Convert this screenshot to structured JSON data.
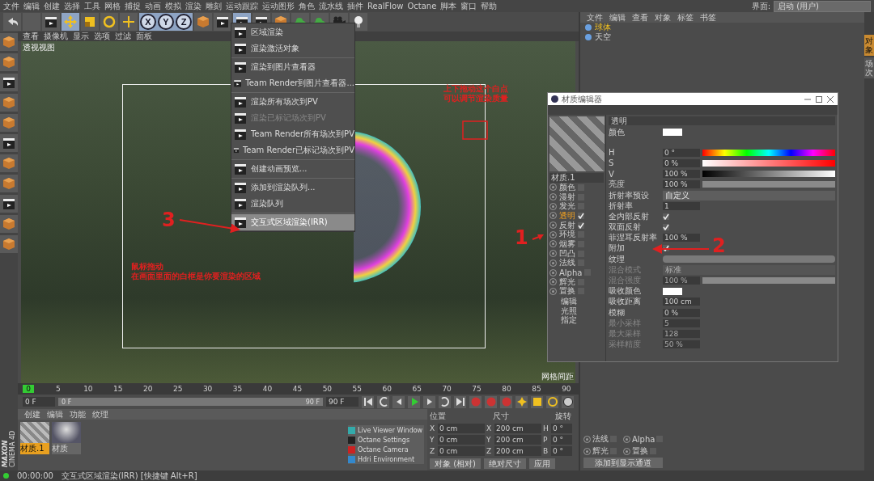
{
  "menu_bar": [
    "文件",
    "编辑",
    "创建",
    "选择",
    "工具",
    "网格",
    "捕捉",
    "动画",
    "模拟",
    "渲染",
    "雕刻",
    "运动跟踪",
    "运动图形",
    "角色",
    "流水线",
    "插件",
    "RealFlow",
    "Octane",
    "脚本",
    "窗口",
    "帮助"
  ],
  "layout_selector": {
    "label": "界面:",
    "value": "启动 (用户)"
  },
  "toolbar": {
    "axes": [
      "X",
      "Y",
      "Z"
    ]
  },
  "viewport": {
    "menu": [
      "查看",
      "摄像机",
      "显示",
      "选项",
      "过滤",
      "面板"
    ],
    "title": "透视视图",
    "footer": "网格间距"
  },
  "render_menu": [
    {
      "label": "区域渲染",
      "disabled": false,
      "selected": false,
      "separator_before": false
    },
    {
      "label": "渲染激活对象",
      "disabled": false,
      "selected": false,
      "separator_before": false
    },
    {
      "label": "渲染到图片查看器",
      "disabled": false,
      "selected": false,
      "separator_before": true
    },
    {
      "label": "Team Render到图片查看器...",
      "disabled": false,
      "selected": false,
      "separator_before": false
    },
    {
      "label": "渲染所有场次到PV",
      "disabled": false,
      "selected": false,
      "separator_before": true
    },
    {
      "label": "渲染已标记场次到PV",
      "disabled": true,
      "selected": false,
      "separator_before": false
    },
    {
      "label": "Team Render所有场次到PV",
      "disabled": false,
      "selected": false,
      "separator_before": false
    },
    {
      "label": "Team Render已标记场次到PV",
      "disabled": false,
      "selected": false,
      "separator_before": false
    },
    {
      "label": "创建动画预览...",
      "disabled": false,
      "selected": false,
      "separator_before": true
    },
    {
      "label": "添加到渲染队列...",
      "disabled": false,
      "selected": false,
      "separator_before": true
    },
    {
      "label": "渲染队列",
      "disabled": false,
      "selected": false,
      "separator_before": false
    },
    {
      "label": "交互式区域渲染(IRR)",
      "disabled": false,
      "selected": true,
      "separator_before": true
    }
  ],
  "annotations": [
    {
      "kind": "note",
      "lines": [
        "上下拖动这个白点",
        "可以调节渲染质量"
      ]
    },
    {
      "kind": "number",
      "text": "3"
    },
    {
      "kind": "number",
      "text": "1"
    },
    {
      "kind": "number",
      "text": "2"
    },
    {
      "kind": "note",
      "lines": [
        "鼠标拖动",
        "在画面里面的白框是你要渲染的区域"
      ]
    }
  ],
  "object_manager": {
    "menu": [
      "文件",
      "编辑",
      "查看",
      "对象",
      "标签",
      "书签"
    ],
    "objects": [
      {
        "name": "球体",
        "selected": true
      },
      {
        "name": "天空",
        "selected": false
      }
    ]
  },
  "side_tabs": [
    {
      "label": "对象",
      "selected": true
    },
    {
      "label": "场次",
      "selected": false
    }
  ],
  "material_editor": {
    "title": "材质编辑器",
    "material_name": "材质.1",
    "channels": [
      {
        "label": "颜色",
        "checked": false,
        "selected": false
      },
      {
        "label": "漫射",
        "checked": false,
        "selected": false
      },
      {
        "label": "发光",
        "checked": false,
        "selected": false
      },
      {
        "label": "透明",
        "checked": true,
        "selected": true
      },
      {
        "label": "反射",
        "checked": true,
        "selected": false
      },
      {
        "label": "环境",
        "checked": false,
        "selected": false
      },
      {
        "label": "烟雾",
        "checked": false,
        "selected": false
      },
      {
        "label": "凹凸",
        "checked": false,
        "selected": false
      },
      {
        "label": "法线",
        "checked": false,
        "selected": false
      },
      {
        "label": "Alpha",
        "checked": false,
        "selected": false
      },
      {
        "label": "辉光",
        "checked": false,
        "selected": false
      },
      {
        "label": "置换",
        "checked": false,
        "selected": false
      }
    ],
    "pages": [
      "编辑",
      "光照",
      "指定"
    ],
    "section": "透明",
    "params": [
      {
        "kind": "color",
        "label": "颜色",
        "color": "#ffffff",
        "disabled": false
      },
      {
        "kind": "hue",
        "label": "H",
        "value": "0 °",
        "disabled": false
      },
      {
        "kind": "saturation",
        "label": "S",
        "value": "0 %",
        "disabled": false
      },
      {
        "kind": "brightness",
        "label": "V",
        "value": "100 %",
        "disabled": false
      },
      {
        "kind": "number",
        "label": "亮度",
        "value": "100 %",
        "level": 1,
        "disabled": false
      },
      {
        "kind": "select",
        "label": "折射率预设",
        "value": "自定义",
        "disabled": false
      },
      {
        "kind": "number",
        "label": "折射率",
        "value": "1",
        "disabled": false
      },
      {
        "kind": "check",
        "label": "全内部反射",
        "checked": true,
        "disabled": false
      },
      {
        "kind": "check",
        "label": "双面反射",
        "checked": true,
        "disabled": false
      },
      {
        "kind": "number",
        "label": "菲涅耳反射率",
        "value": "100 %",
        "disabled": false
      },
      {
        "kind": "check",
        "label": "附加",
        "checked": true,
        "disabled": false
      },
      {
        "kind": "texture",
        "label": "纹理",
        "disabled": false
      },
      {
        "kind": "select",
        "label": "混合模式",
        "value": "标准",
        "disabled": true
      },
      {
        "kind": "number",
        "label": "混合强度",
        "value": "100 %",
        "level": 1,
        "disabled": true
      },
      {
        "kind": "color",
        "label": "吸收颜色",
        "color": "#ffffff",
        "disabled": false
      },
      {
        "kind": "number",
        "label": "吸收距离",
        "value": "100 cm",
        "disabled": false
      },
      {
        "kind": "number",
        "label": "模糊",
        "value": "0 %",
        "disabled": false
      },
      {
        "kind": "number",
        "label": "最小采样",
        "value": "5",
        "disabled": true
      },
      {
        "kind": "number",
        "label": "最大采样",
        "value": "128",
        "disabled": true
      },
      {
        "kind": "number",
        "label": "采样精度",
        "value": "50 %",
        "disabled": true
      }
    ]
  },
  "timeline": {
    "ticks": [
      "0",
      "5",
      "10",
      "15",
      "20",
      "25",
      "30",
      "35",
      "40",
      "45",
      "50",
      "55",
      "60",
      "65",
      "70",
      "75",
      "80",
      "85",
      "90"
    ],
    "start": "0 F",
    "level": 1,
    "range_start": "0 F",
    "range_end": "90 F",
    "end": "90 F"
  },
  "material_panel": {
    "menu": [
      "创建",
      "编辑",
      "功能",
      "纹理"
    ],
    "materials": [
      {
        "name": "材质.1",
        "selected": true
      },
      {
        "name": "材质",
        "selected": false
      }
    ]
  },
  "octane_menu": [
    "Live Viewer Window",
    "Octane Settings",
    "Octane Camera",
    "Hdri Environment"
  ],
  "coordinates": {
    "headers": [
      "位置",
      "尺寸",
      "旋转"
    ],
    "rows": [
      {
        "pos_axis": "X",
        "position": "0 cm",
        "size_axis": "X",
        "size": "200 cm",
        "rot_axis": "H",
        "rotation": "0 °"
      },
      {
        "pos_axis": "Y",
        "position": "0 cm",
        "size_axis": "Y",
        "size": "200 cm",
        "rot_axis": "P",
        "rotation": "0 °"
      },
      {
        "pos_axis": "Z",
        "position": "0 cm",
        "size_axis": "Z",
        "size": "200 cm",
        "rot_axis": "B",
        "rotation": "0 °"
      }
    ],
    "selectors": [
      "对象 (相对)",
      "绝对尺寸"
    ],
    "apply": "应用"
  },
  "attributes": {
    "channels": [
      {
        "label": "法线",
        "checked": false
      },
      {
        "label": "Alpha",
        "checked": false
      },
      {
        "label": "辉光",
        "checked": false
      },
      {
        "label": "置换",
        "checked": false
      }
    ],
    "button": "添加到显示通道"
  },
  "logo": [
    "MAXON",
    "CINEMA 4D"
  ],
  "status_bar": {
    "time": "00:00:00",
    "message": "交互式区域渲染(IRR) [快捷键 Alt+R]"
  }
}
